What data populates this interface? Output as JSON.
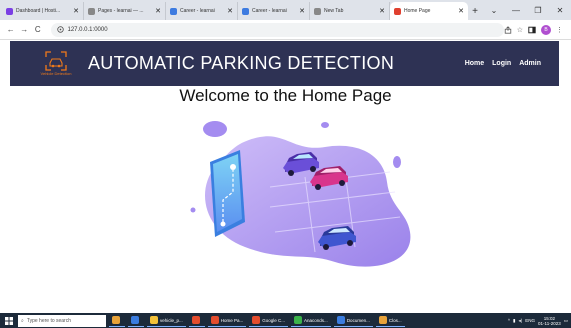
{
  "browser": {
    "tabs": [
      {
        "title": "Dashboard | Hosti...",
        "favicon_color": "#7b3fe4"
      },
      {
        "title": "Pages - learnai — ...",
        "favicon_color": "#888888"
      },
      {
        "title": "Career - learnai",
        "favicon_color": "#3d7be0"
      },
      {
        "title": "Career - learnai",
        "favicon_color": "#3d7be0"
      },
      {
        "title": "New Tab",
        "favicon_color": "#888888"
      },
      {
        "title": "Home Page",
        "favicon_color": "#e0402f"
      }
    ],
    "active_tab_index": 5,
    "new_tab_label": "+",
    "window_controls": [
      "⌄",
      "—",
      "❐",
      "✕"
    ],
    "nav": {
      "back": "←",
      "forward": "→",
      "reload": "C"
    },
    "url": "127.0.0.1:0000",
    "profile_initial": "B"
  },
  "site": {
    "logo_text": "Vehicle Detection",
    "brand": "AUTOMATIC PARKING DETECTION",
    "nav_links": [
      "Home",
      "Login",
      "Admin"
    ],
    "header_color": "#2e3254",
    "welcome": "Welcome to the Home Page"
  },
  "taskbar": {
    "search_placeholder": "Type here to search",
    "items": [
      {
        "label": "",
        "color": "#e8a33a"
      },
      {
        "label": "",
        "color": "#3b7de0"
      },
      {
        "label": "vehicle_p...",
        "color": "#f3c23a"
      },
      {
        "label": "",
        "color": "#e44d2e"
      },
      {
        "label": "Home Pa...",
        "color": "#e44d2e"
      },
      {
        "label": "Google C...",
        "color": "#e44d2e"
      },
      {
        "label": "Anaconds...",
        "color": "#3cb44b"
      },
      {
        "label": "Documen...",
        "color": "#3b7de0"
      },
      {
        "label": "Clos...",
        "color": "#e8a33a"
      }
    ],
    "tray_lang": "ENG",
    "time": "15:02",
    "date": "01-11-2023"
  }
}
